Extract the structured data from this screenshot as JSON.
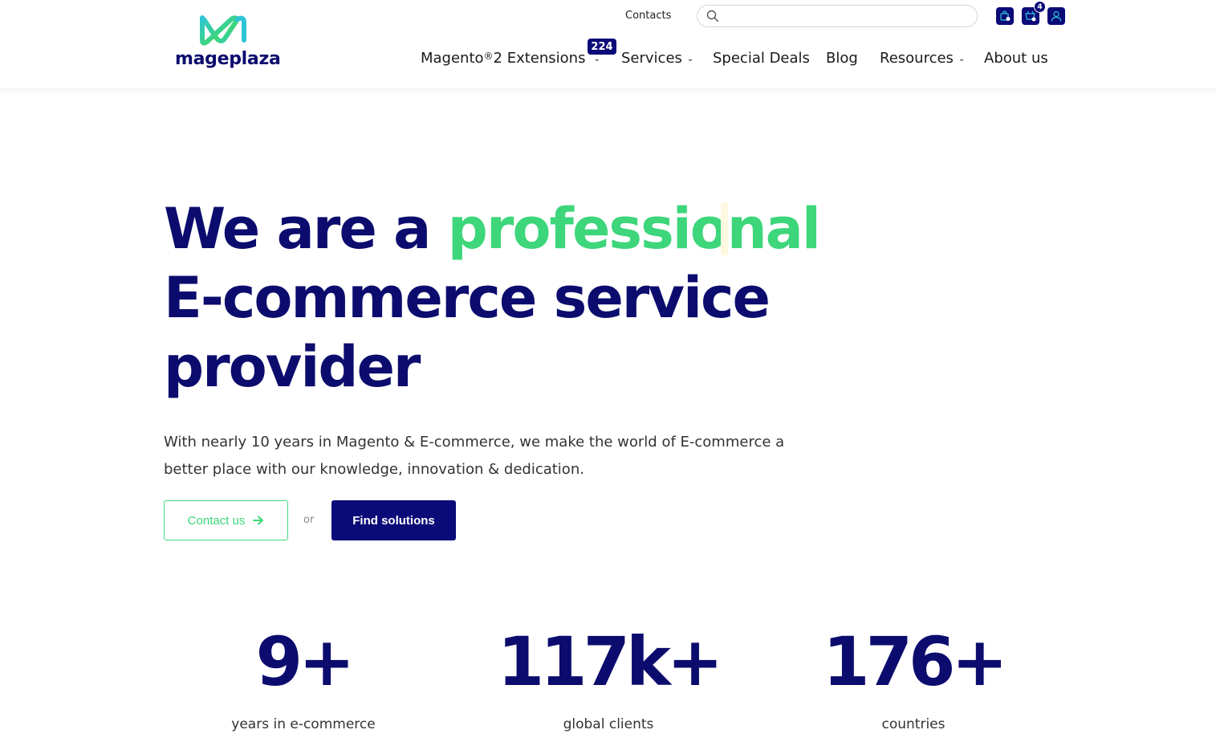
{
  "header": {
    "logo_text": "mageplaza",
    "contacts_label": "Contacts",
    "search": {
      "placeholder": "",
      "value": ""
    },
    "icons": [
      "shopping-bag-icon",
      "cart-icon",
      "user-icon"
    ],
    "cart_count": "4",
    "nav": [
      {
        "label": "Magento",
        "sup": "®",
        "label_rest": " 2 Extensions",
        "badge": "224",
        "has_dropdown": true
      },
      {
        "label": "Services",
        "has_dropdown": true
      },
      {
        "label": "Special Deals",
        "has_dropdown": false
      },
      {
        "label": "Blog",
        "has_dropdown": false
      },
      {
        "label": "Resources",
        "has_dropdown": true
      },
      {
        "label": "About us",
        "has_dropdown": false
      }
    ]
  },
  "hero": {
    "title_part1": "We are a ",
    "title_accent": "professional",
    "title_line2": "E-commerce service",
    "title_line3": "provider",
    "description": "With nearly 10 years in Magento & E-commerce, we make the world of E-commerce a better place with our knowledge, innovation & dedication.",
    "contact_button": "Contact us",
    "or_text": "or",
    "find_button": "Find solutions"
  },
  "stats": [
    {
      "value": "9+",
      "label": "years in e-commerce"
    },
    {
      "value": "117k+",
      "label": "global clients"
    },
    {
      "value": "176+",
      "label": "countries"
    }
  ],
  "colors": {
    "brand_navy": "#0a0a78",
    "accent_green": "#3dd67a",
    "logo_teal": "#2ec4d6"
  }
}
